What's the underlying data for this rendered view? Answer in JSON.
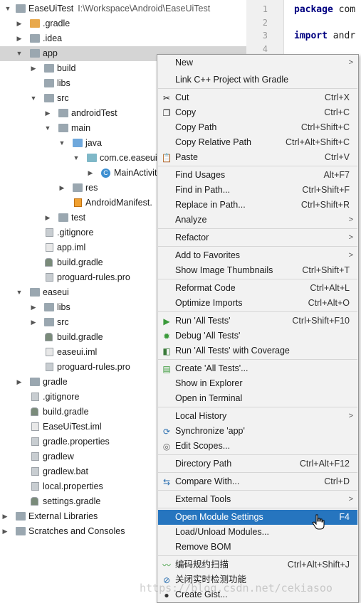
{
  "project_tree": {
    "rows": [
      {
        "label": "EaseUiTest",
        "path": "I:\\Workspace\\Android\\EaseUiTest"
      },
      {
        "label": ".gradle"
      },
      {
        "label": ".idea"
      },
      {
        "label": "app"
      },
      {
        "label": "build"
      },
      {
        "label": "libs"
      },
      {
        "label": "src"
      },
      {
        "label": "androidTest"
      },
      {
        "label": "main"
      },
      {
        "label": "java"
      },
      {
        "label": "com.ce.easeui"
      },
      {
        "label": "MainActivit"
      },
      {
        "label": "res"
      },
      {
        "label": "AndroidManifest."
      },
      {
        "label": "test"
      },
      {
        "label": ".gitignore"
      },
      {
        "label": "app.iml"
      },
      {
        "label": "build.gradle"
      },
      {
        "label": "proguard-rules.pro"
      },
      {
        "label": "easeui"
      },
      {
        "label": "libs"
      },
      {
        "label": "src"
      },
      {
        "label": "build.gradle"
      },
      {
        "label": "easeui.iml"
      },
      {
        "label": "proguard-rules.pro"
      },
      {
        "label": "gradle"
      },
      {
        "label": ".gitignore"
      },
      {
        "label": "build.gradle"
      },
      {
        "label": "EaseUiTest.iml"
      },
      {
        "label": "gradle.properties"
      },
      {
        "label": "gradlew"
      },
      {
        "label": "gradlew.bat"
      },
      {
        "label": "local.properties"
      },
      {
        "label": "settings.gradle"
      },
      {
        "label": "External Libraries"
      },
      {
        "label": "Scratches and Consoles"
      }
    ]
  },
  "editor": {
    "line_numbers": [
      "1",
      "2",
      "3",
      "4"
    ],
    "lines": [
      {
        "keyword": "package",
        "rest": " com"
      },
      {
        "keyword": "",
        "rest": ""
      },
      {
        "keyword": "import",
        "rest": " andr"
      }
    ]
  },
  "context_menu": {
    "items": [
      {
        "label": "New",
        "shortcut": "",
        "submenu": true
      },
      {
        "label": "Link C++ Project with Gradle",
        "shortcut": ""
      },
      {
        "label": "Cut",
        "shortcut": "Ctrl+X"
      },
      {
        "label": "Copy",
        "shortcut": "Ctrl+C"
      },
      {
        "label": "Copy Path",
        "shortcut": "Ctrl+Shift+C"
      },
      {
        "label": "Copy Relative Path",
        "shortcut": "Ctrl+Alt+Shift+C"
      },
      {
        "label": "Paste",
        "shortcut": "Ctrl+V"
      },
      {
        "label": "Find Usages",
        "shortcut": "Alt+F7"
      },
      {
        "label": "Find in Path...",
        "shortcut": "Ctrl+Shift+F"
      },
      {
        "label": "Replace in Path...",
        "shortcut": "Ctrl+Shift+R"
      },
      {
        "label": "Analyze",
        "shortcut": "",
        "submenu": true
      },
      {
        "label": "Refactor",
        "shortcut": "",
        "submenu": true
      },
      {
        "label": "Add to Favorites",
        "shortcut": "",
        "submenu": true
      },
      {
        "label": "Show Image Thumbnails",
        "shortcut": "Ctrl+Shift+T"
      },
      {
        "label": "Reformat Code",
        "shortcut": "Ctrl+Alt+L"
      },
      {
        "label": "Optimize Imports",
        "shortcut": "Ctrl+Alt+O"
      },
      {
        "label": "Run 'All Tests'",
        "shortcut": "Ctrl+Shift+F10"
      },
      {
        "label": "Debug 'All Tests'",
        "shortcut": ""
      },
      {
        "label": "Run 'All Tests' with Coverage",
        "shortcut": ""
      },
      {
        "label": "Create 'All Tests'...",
        "shortcut": ""
      },
      {
        "label": "Show in Explorer",
        "shortcut": ""
      },
      {
        "label": "Open in Terminal",
        "shortcut": ""
      },
      {
        "label": "Local History",
        "shortcut": "",
        "submenu": true
      },
      {
        "label": "Synchronize 'app'",
        "shortcut": ""
      },
      {
        "label": "Edit Scopes...",
        "shortcut": ""
      },
      {
        "label": "Directory Path",
        "shortcut": "Ctrl+Alt+F12"
      },
      {
        "label": "Compare With...",
        "shortcut": "Ctrl+D"
      },
      {
        "label": "External Tools",
        "shortcut": "",
        "submenu": true
      },
      {
        "label": "Open Module Settings",
        "shortcut": "F4"
      },
      {
        "label": "Load/Unload Modules...",
        "shortcut": ""
      },
      {
        "label": "Remove BOM",
        "shortcut": ""
      },
      {
        "label": "编码规约扫描",
        "shortcut": "Ctrl+Alt+Shift+J"
      },
      {
        "label": "关闭实时检测功能",
        "shortcut": ""
      },
      {
        "label": "Create Gist...",
        "shortcut": ""
      }
    ],
    "submenu_arrow": ">"
  },
  "watermark": "https://blog.csdn.net/cekiasoo",
  "colors": {
    "highlight": "#2675bf",
    "selected_row": "#d5d5d5",
    "menu_bg": "#f2f2f2"
  }
}
